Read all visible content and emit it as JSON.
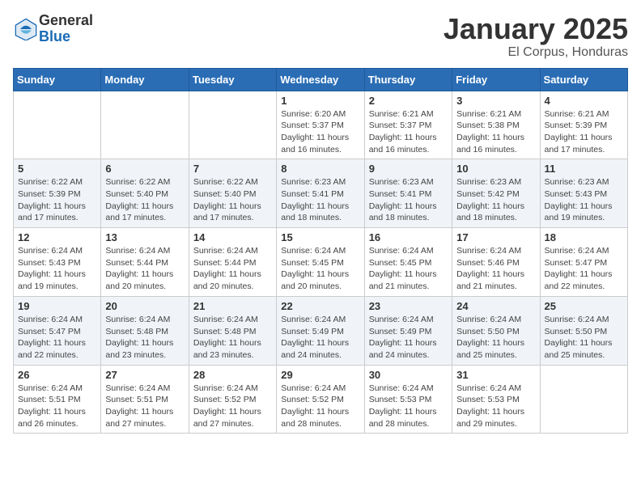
{
  "header": {
    "logo_general": "General",
    "logo_blue": "Blue",
    "title": "January 2025",
    "location": "El Corpus, Honduras"
  },
  "days_of_week": [
    "Sunday",
    "Monday",
    "Tuesday",
    "Wednesday",
    "Thursday",
    "Friday",
    "Saturday"
  ],
  "weeks": [
    [
      {
        "day": "",
        "info": ""
      },
      {
        "day": "",
        "info": ""
      },
      {
        "day": "",
        "info": ""
      },
      {
        "day": "1",
        "info": "Sunrise: 6:20 AM\nSunset: 5:37 PM\nDaylight: 11 hours and 16 minutes."
      },
      {
        "day": "2",
        "info": "Sunrise: 6:21 AM\nSunset: 5:37 PM\nDaylight: 11 hours and 16 minutes."
      },
      {
        "day": "3",
        "info": "Sunrise: 6:21 AM\nSunset: 5:38 PM\nDaylight: 11 hours and 16 minutes."
      },
      {
        "day": "4",
        "info": "Sunrise: 6:21 AM\nSunset: 5:39 PM\nDaylight: 11 hours and 17 minutes."
      }
    ],
    [
      {
        "day": "5",
        "info": "Sunrise: 6:22 AM\nSunset: 5:39 PM\nDaylight: 11 hours and 17 minutes."
      },
      {
        "day": "6",
        "info": "Sunrise: 6:22 AM\nSunset: 5:40 PM\nDaylight: 11 hours and 17 minutes."
      },
      {
        "day": "7",
        "info": "Sunrise: 6:22 AM\nSunset: 5:40 PM\nDaylight: 11 hours and 17 minutes."
      },
      {
        "day": "8",
        "info": "Sunrise: 6:23 AM\nSunset: 5:41 PM\nDaylight: 11 hours and 18 minutes."
      },
      {
        "day": "9",
        "info": "Sunrise: 6:23 AM\nSunset: 5:41 PM\nDaylight: 11 hours and 18 minutes."
      },
      {
        "day": "10",
        "info": "Sunrise: 6:23 AM\nSunset: 5:42 PM\nDaylight: 11 hours and 18 minutes."
      },
      {
        "day": "11",
        "info": "Sunrise: 6:23 AM\nSunset: 5:43 PM\nDaylight: 11 hours and 19 minutes."
      }
    ],
    [
      {
        "day": "12",
        "info": "Sunrise: 6:24 AM\nSunset: 5:43 PM\nDaylight: 11 hours and 19 minutes."
      },
      {
        "day": "13",
        "info": "Sunrise: 6:24 AM\nSunset: 5:44 PM\nDaylight: 11 hours and 20 minutes."
      },
      {
        "day": "14",
        "info": "Sunrise: 6:24 AM\nSunset: 5:44 PM\nDaylight: 11 hours and 20 minutes."
      },
      {
        "day": "15",
        "info": "Sunrise: 6:24 AM\nSunset: 5:45 PM\nDaylight: 11 hours and 20 minutes."
      },
      {
        "day": "16",
        "info": "Sunrise: 6:24 AM\nSunset: 5:45 PM\nDaylight: 11 hours and 21 minutes."
      },
      {
        "day": "17",
        "info": "Sunrise: 6:24 AM\nSunset: 5:46 PM\nDaylight: 11 hours and 21 minutes."
      },
      {
        "day": "18",
        "info": "Sunrise: 6:24 AM\nSunset: 5:47 PM\nDaylight: 11 hours and 22 minutes."
      }
    ],
    [
      {
        "day": "19",
        "info": "Sunrise: 6:24 AM\nSunset: 5:47 PM\nDaylight: 11 hours and 22 minutes."
      },
      {
        "day": "20",
        "info": "Sunrise: 6:24 AM\nSunset: 5:48 PM\nDaylight: 11 hours and 23 minutes."
      },
      {
        "day": "21",
        "info": "Sunrise: 6:24 AM\nSunset: 5:48 PM\nDaylight: 11 hours and 23 minutes."
      },
      {
        "day": "22",
        "info": "Sunrise: 6:24 AM\nSunset: 5:49 PM\nDaylight: 11 hours and 24 minutes."
      },
      {
        "day": "23",
        "info": "Sunrise: 6:24 AM\nSunset: 5:49 PM\nDaylight: 11 hours and 24 minutes."
      },
      {
        "day": "24",
        "info": "Sunrise: 6:24 AM\nSunset: 5:50 PM\nDaylight: 11 hours and 25 minutes."
      },
      {
        "day": "25",
        "info": "Sunrise: 6:24 AM\nSunset: 5:50 PM\nDaylight: 11 hours and 25 minutes."
      }
    ],
    [
      {
        "day": "26",
        "info": "Sunrise: 6:24 AM\nSunset: 5:51 PM\nDaylight: 11 hours and 26 minutes."
      },
      {
        "day": "27",
        "info": "Sunrise: 6:24 AM\nSunset: 5:51 PM\nDaylight: 11 hours and 27 minutes."
      },
      {
        "day": "28",
        "info": "Sunrise: 6:24 AM\nSunset: 5:52 PM\nDaylight: 11 hours and 27 minutes."
      },
      {
        "day": "29",
        "info": "Sunrise: 6:24 AM\nSunset: 5:52 PM\nDaylight: 11 hours and 28 minutes."
      },
      {
        "day": "30",
        "info": "Sunrise: 6:24 AM\nSunset: 5:53 PM\nDaylight: 11 hours and 28 minutes."
      },
      {
        "day": "31",
        "info": "Sunrise: 6:24 AM\nSunset: 5:53 PM\nDaylight: 11 hours and 29 minutes."
      },
      {
        "day": "",
        "info": ""
      }
    ]
  ]
}
